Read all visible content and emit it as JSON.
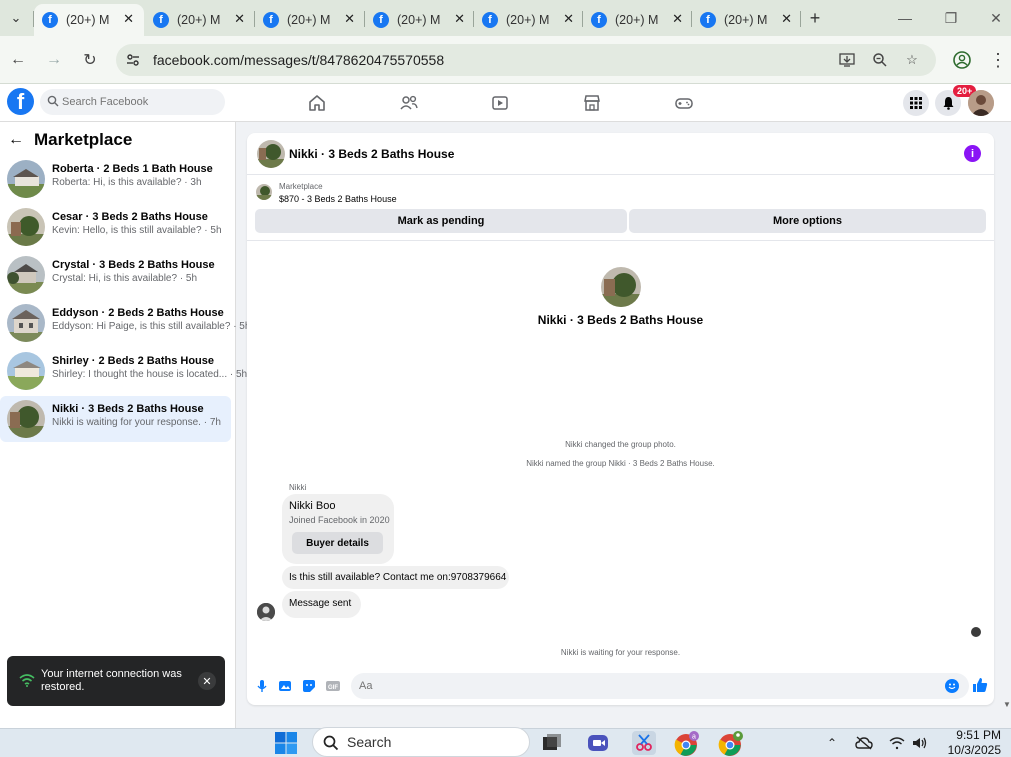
{
  "browser": {
    "tabs": [
      {
        "title": "(20+) M",
        "active": true
      },
      {
        "title": "(20+) M",
        "active": false
      },
      {
        "title": "(20+) M",
        "active": false
      },
      {
        "title": "(20+) M",
        "active": false
      },
      {
        "title": "(20+) M",
        "active": false
      },
      {
        "title": "(20+) M",
        "active": false
      },
      {
        "title": "(20+) M",
        "active": false
      }
    ],
    "url": "facebook.com/messages/t/8478620475570558"
  },
  "fb": {
    "search_placeholder": "Search Facebook",
    "notification_badge": "20+",
    "brand_color": "#1877f2"
  },
  "sidebar": {
    "title": "Marketplace",
    "conversations": [
      {
        "title": "Roberta · 2 Beds 1 Bath House",
        "snippet": "Roberta: Hi, is this available? · 3h",
        "selected": false
      },
      {
        "title": "Cesar · 3 Beds 2 Baths House",
        "snippet": "Kevin: Hello, is this still available? · 5h",
        "selected": false
      },
      {
        "title": "Crystal · 3 Beds 2 Baths House",
        "snippet": "Crystal: Hi, is this available? · 5h",
        "selected": false
      },
      {
        "title": "Eddyson · 2 Beds 2 Baths House",
        "snippet": "Eddyson: Hi Paige, is this still available? · 5h",
        "selected": false
      },
      {
        "title": "Shirley · 2 Beds 2 Baths House",
        "snippet": "Shirley: I thought the house is located... · 5h",
        "selected": false
      },
      {
        "title": "Nikki · 3 Beds 2 Baths House",
        "snippet": "Nikki is waiting for your response. · 7h",
        "selected": true
      }
    ]
  },
  "toast": {
    "message": "Your internet connection was restored."
  },
  "chat": {
    "title": "Nikki · 3 Beds 2 Baths House",
    "listing_category": "Marketplace",
    "listing_price": "$870 - 3 Beds 2 Baths House",
    "mark_pending_label": "Mark as pending",
    "more_options_label": "More options",
    "center_name": "Nikki · 3 Beds 2 Baths House",
    "system_messages": [
      "Nikki changed the group photo.",
      "Nikki named the group Nikki · 3 Beds 2 Baths House."
    ],
    "sender_label": "Nikki",
    "buyer_card": {
      "name": "Nikki Boo",
      "joined": "Joined Facebook in 2020",
      "button": "Buyer details"
    },
    "message_1": "Is this still available? Contact me on:9708379664",
    "message_2": "Message sent",
    "waiting_note": "Nikki is waiting for your response.",
    "composer_placeholder": "Aa"
  },
  "taskbar": {
    "search_label": "Search",
    "time": "9:51 PM",
    "date": "10/3/2025"
  }
}
